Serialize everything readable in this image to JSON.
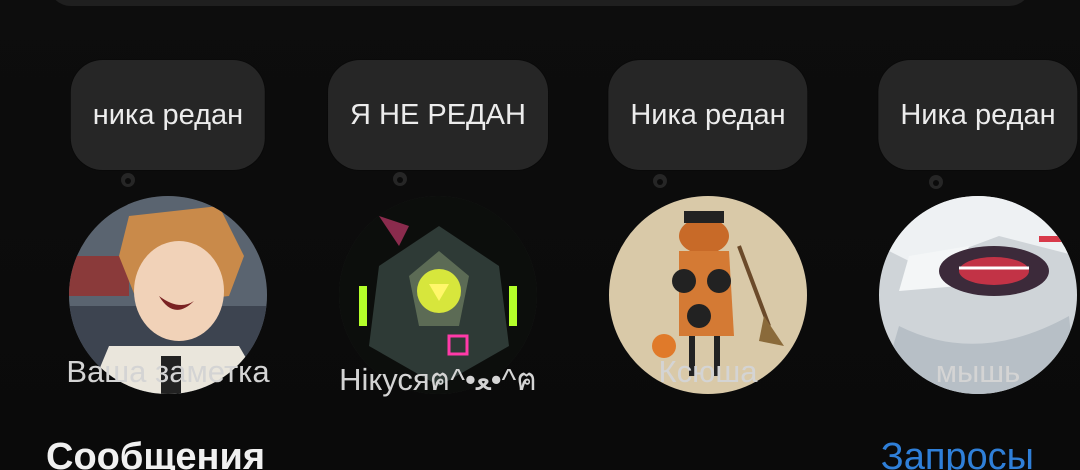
{
  "notes": [
    {
      "note_text": "ника редан",
      "name": "Ваша заметка",
      "avatar_desc": "anime-boy-avatar"
    },
    {
      "note_text": "Я НЕ РЕДАН",
      "name": "Нікусяฅ^•ﻌ•^ฅ",
      "avatar_desc": "armored-robot-avatar"
    },
    {
      "note_text": "Ника редан",
      "name": "Ксюша",
      "avatar_desc": "orange-creature-avatar"
    },
    {
      "note_text": "Ника редан",
      "name": "мышь",
      "avatar_desc": "white-haired-face-avatar"
    }
  ],
  "messages": {
    "title": "Сообщения",
    "requests_label": "Запросы"
  },
  "colors": {
    "background": "#0b0b0b",
    "bubble": "#262626",
    "link": "#2f7fd8"
  }
}
